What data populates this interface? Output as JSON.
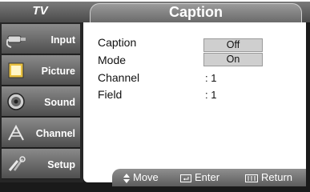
{
  "header": {
    "section_label": "TV",
    "title": "Caption"
  },
  "sidebar": {
    "items": [
      {
        "label": "Input",
        "icon": "input-plug-icon"
      },
      {
        "label": "Picture",
        "icon": "picture-icon"
      },
      {
        "label": "Sound",
        "icon": "sound-speaker-icon"
      },
      {
        "label": "Channel",
        "icon": "channel-antenna-icon"
      },
      {
        "label": "Setup",
        "icon": "setup-tools-icon"
      }
    ]
  },
  "menu": {
    "rows": [
      {
        "label": "Caption",
        "value": "Off"
      },
      {
        "label": "Mode",
        "value": "On"
      },
      {
        "label": "Channel",
        "value": ": 1"
      },
      {
        "label": "Field",
        "value": ": 1"
      }
    ]
  },
  "help_bar": {
    "move": "Move",
    "enter": "Enter",
    "return": "Return"
  },
  "colors": {
    "frame": "#1a1a1a",
    "panel": "#ffffff",
    "highlight_box": "#cfcfcf",
    "bar_gradient_top": "#8f8f8f",
    "bar_gradient_bottom": "#5c5c5c"
  }
}
